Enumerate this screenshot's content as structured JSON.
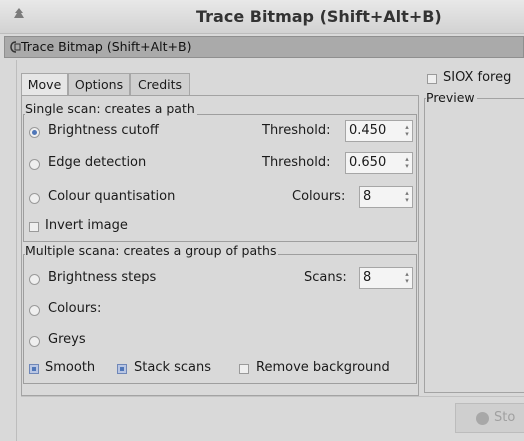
{
  "window": {
    "title": "Trace Bitmap (Shift+Alt+B)"
  },
  "dock": {
    "title": "Trace Bitmap (Shift+Alt+B)"
  },
  "tabs": [
    {
      "label": "Move",
      "active": true
    },
    {
      "label": "Options",
      "active": false
    },
    {
      "label": "Credits",
      "active": false
    }
  ],
  "single_scan": {
    "header": "Single scan: creates a path",
    "brightness": {
      "label": "Brightness cutoff",
      "selected": true,
      "field_label": "Threshold:",
      "value": "0.450"
    },
    "edge": {
      "label": "Edge detection",
      "selected": false,
      "field_label": "Threshold:",
      "value": "0.650"
    },
    "colour_quant": {
      "label": "Colour quantisation",
      "selected": false,
      "field_label": "Colours:",
      "value": "8"
    },
    "invert": {
      "label": "Invert image",
      "checked": false
    }
  },
  "multiple_scan": {
    "header": "Multiple scana: creates a group of paths",
    "brightness_steps": {
      "label": "Brightness steps",
      "selected": false,
      "field_label": "Scans:",
      "value": "8"
    },
    "colours": {
      "label": "Colours:",
      "selected": false
    },
    "greys": {
      "label": "Greys",
      "selected": false
    },
    "smooth": {
      "label": "Smooth",
      "checked": true
    },
    "stack_scans": {
      "label": "Stack scans",
      "checked": true
    },
    "remove_background": {
      "label": "Remove background",
      "checked": false
    }
  },
  "right": {
    "siox_label": "SIOX foreg",
    "preview_label": "Preview",
    "stop_label": "Sto"
  },
  "colors": {
    "accent": "#4f76b8",
    "dock_bg": "#aaaaaa",
    "window_bg": "#d9d9d9"
  }
}
